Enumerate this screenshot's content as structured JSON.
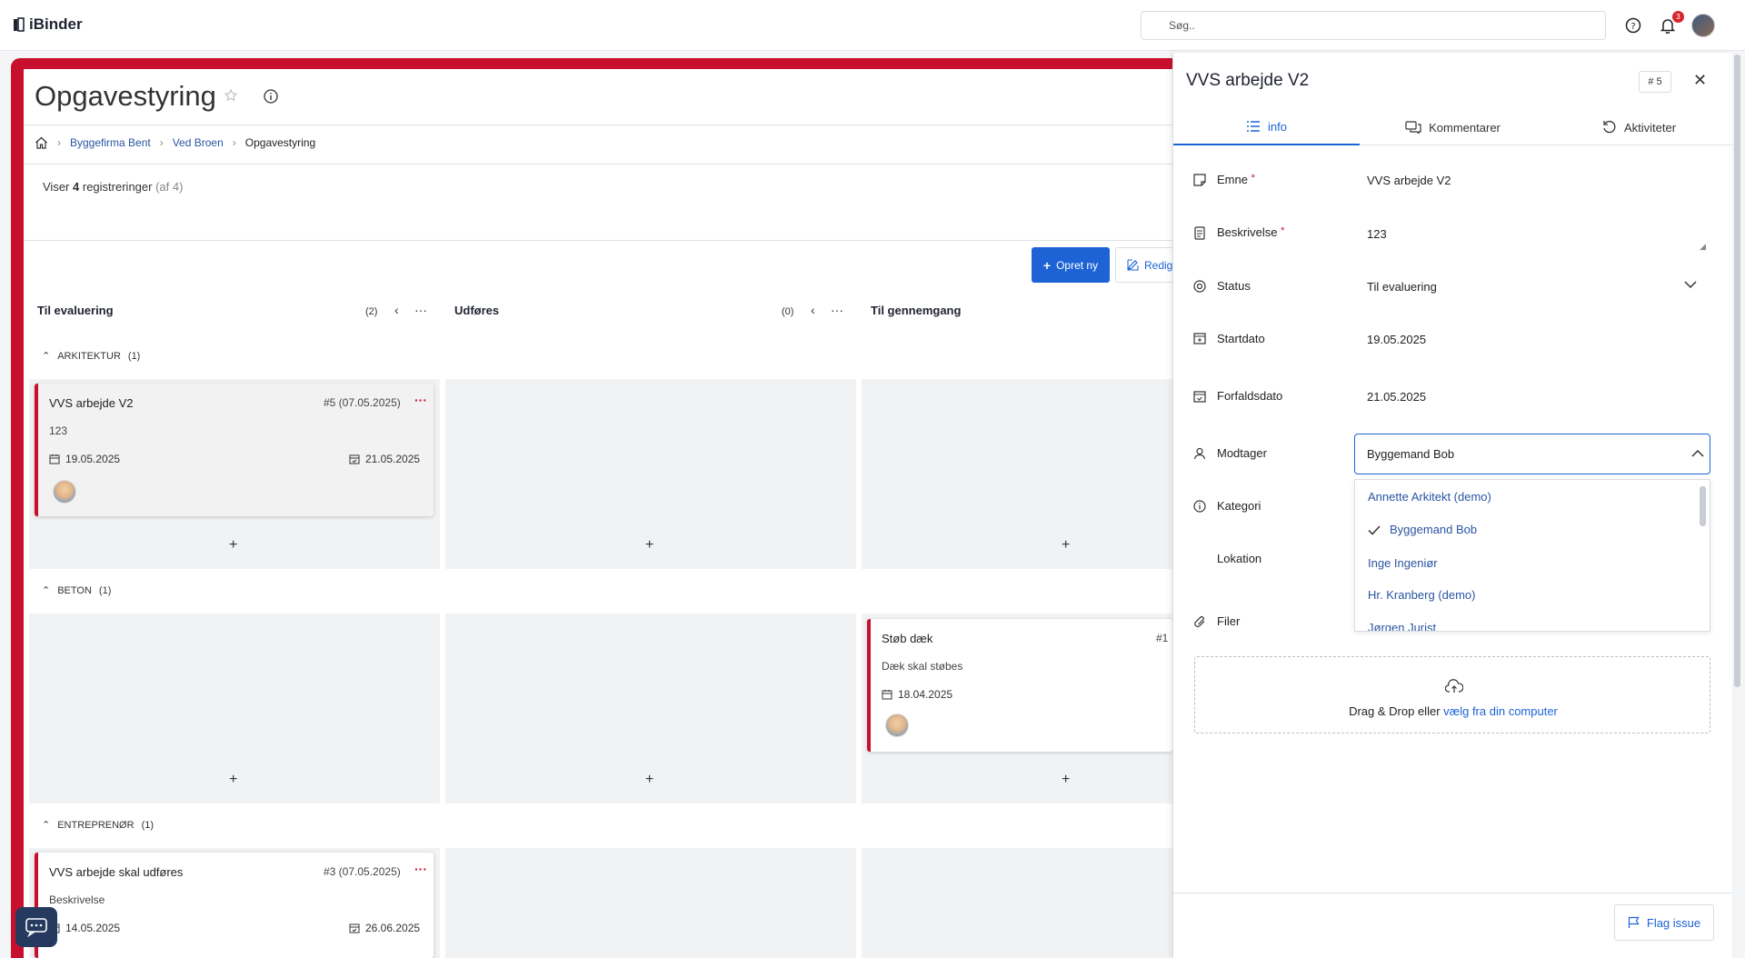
{
  "app": {
    "brand": "iBinder",
    "search_placeholder": "Søg..",
    "notifications_count": "3"
  },
  "page": {
    "title": "Opgavestyring",
    "breadcrumbs": [
      "Byggefirma Bent",
      "Ved Broen",
      "Opgavestyring"
    ],
    "count_prefix": "Viser",
    "count_value": "4",
    "count_suffix": "registreringer",
    "count_total": "(af 4)",
    "btn_new": "Opret ny",
    "btn_edit": "Redige"
  },
  "columns": [
    {
      "name": "Til evaluering",
      "count": "(2)"
    },
    {
      "name": "Udføres",
      "count": "(0)"
    },
    {
      "name": "Til gennemgang"
    }
  ],
  "groups": [
    {
      "name": "ARKITEKTUR",
      "count": "(1)"
    },
    {
      "name": "BETON",
      "count": "(1)"
    },
    {
      "name": "ENTREPRENØR",
      "count": "(1)"
    }
  ],
  "cards": {
    "c1": {
      "title": "VVS arbejde V2",
      "num": "#5 (07.05.2025)",
      "desc": "123",
      "start": "19.05.2025",
      "due": "21.05.2025"
    },
    "c2": {
      "title": "Støb dæk",
      "num": "#1",
      "desc": "Dæk skal støbes",
      "start": "18.04.2025"
    },
    "c3": {
      "title": "VVS arbejde skal udføres",
      "num": "#3 (07.05.2025)",
      "desc": "Beskrivelse",
      "start": "14.05.2025",
      "due": "26.06.2025"
    }
  },
  "panel": {
    "title": "VVS arbejde V2",
    "number": "# 5",
    "tabs": [
      "info",
      "Kommentarer",
      "Aktiviteter"
    ],
    "fields": {
      "emne_label": "Emne",
      "emne_value": "VVS arbejde V2",
      "beskrivelse_label": "Beskrivelse",
      "beskrivelse_value": "123",
      "status_label": "Status",
      "status_value": "Til evaluering",
      "startdato_label": "Startdato",
      "startdato_value": "19.05.2025",
      "forfaldsdato_label": "Forfaldsdato",
      "forfaldsdato_value": "21.05.2025",
      "modtager_label": "Modtager",
      "modtager_value": "Byggemand Bob",
      "kategori_label": "Kategori",
      "lokation_label": "Lokation",
      "filer_label": "Filer"
    },
    "recipient_options": [
      "Annette Arkitekt (demo)",
      "Byggemand Bob",
      "Inge Ingeniør",
      "Hr. Kranberg (demo)",
      "Jørgen Jurist"
    ],
    "dropzone_text": "Drag & Drop eller",
    "dropzone_link": "vælg fra din computer",
    "flag_label": "Flag issue"
  },
  "colors": {
    "brand_red": "#c8102e",
    "primary_blue": "#1d63d6"
  }
}
